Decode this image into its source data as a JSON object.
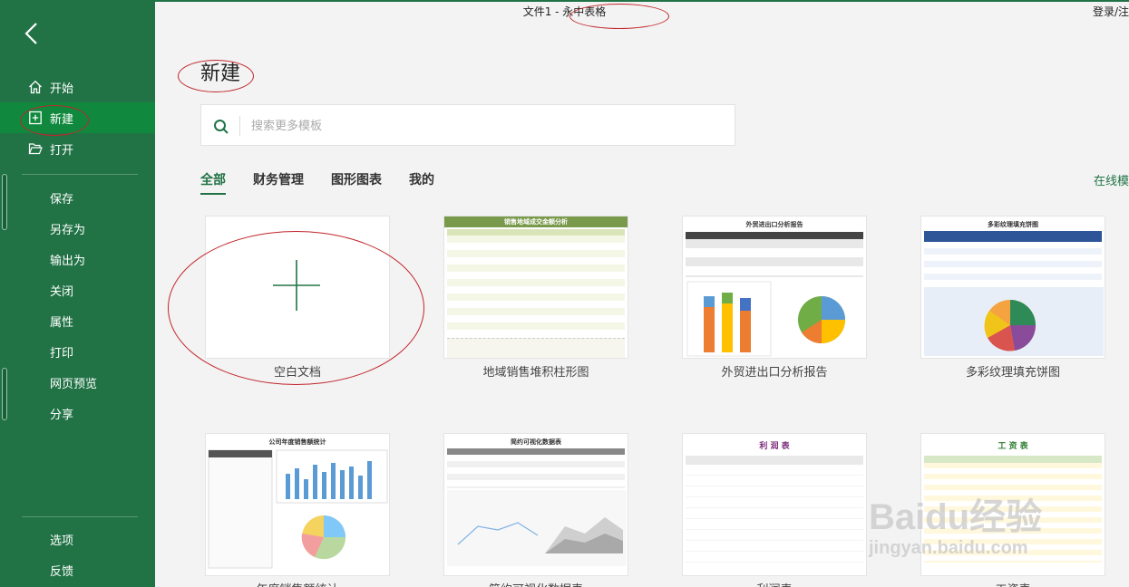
{
  "window": {
    "title": "文件1 - 永中表格",
    "login_label": "登录/注"
  },
  "sidebar": {
    "back_icon": "chevron-left-icon",
    "primary": [
      {
        "label": "开始",
        "icon": "home-icon"
      },
      {
        "label": "新建",
        "icon": "new-file-icon",
        "active": true
      },
      {
        "label": "打开",
        "icon": "folder-open-icon"
      }
    ],
    "actions": [
      "保存",
      "另存为",
      "输出为",
      "关闭",
      "属性",
      "打印",
      "网页预览",
      "分享"
    ],
    "bottom": [
      "选项",
      "反馈"
    ]
  },
  "page": {
    "title": "新建",
    "search_placeholder": "搜索更多模板",
    "tabs": [
      "全部",
      "财务管理",
      "图形图表",
      "我的"
    ],
    "online_label": "在线模"
  },
  "templates": [
    {
      "label": "空白文档"
    },
    {
      "label": "地域销售堆积柱形图",
      "thumb_title": "销售地域成交金额分析"
    },
    {
      "label": "外贸进出口分析报告",
      "thumb_title": "外贸进出口分析报告"
    },
    {
      "label": "多彩纹理填充饼图",
      "thumb_title": "多彩纹理填充饼图"
    },
    {
      "label": "年度销售额统计",
      "thumb_title": "公司年度销售额统计"
    },
    {
      "label": "简约可视化数据表",
      "thumb_title": "简约可视化数据表"
    },
    {
      "label": "利润表",
      "thumb_title": "利 润 表"
    },
    {
      "label": "工资表",
      "thumb_title": "工 资 表"
    }
  ],
  "colors": {
    "brand": "#217346",
    "active_nav": "#10893e",
    "annotation": "#c0262c"
  },
  "watermark": {
    "brand": "Baidu经验",
    "url": "jingyan.baidu.com"
  }
}
